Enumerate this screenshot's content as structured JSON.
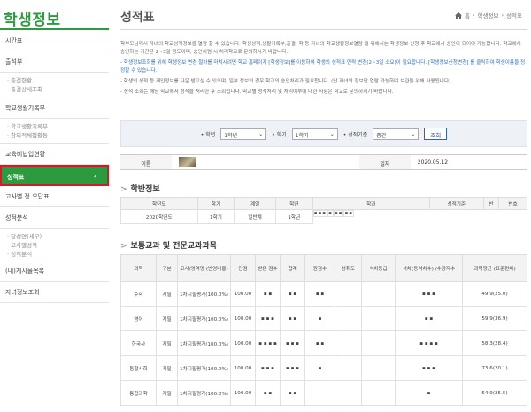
{
  "sidebar": {
    "title": "학생정보",
    "items": [
      {
        "label": "시간표"
      },
      {
        "label": "출석부"
      },
      {
        "label": "출결현황 · 출결상세조회",
        "sub": [
          "· 출결현황",
          "· 출결상세조회"
        ]
      },
      {
        "label": "학교생활기록부"
      },
      {
        "label": "· 학교생활기록부 · 창의적체험활동",
        "sub": [
          "· 학교생활기록부",
          "· 창의적체험활동"
        ]
      },
      {
        "label": "교육비납입현황"
      },
      {
        "label": "성적표",
        "active": true
      },
      {
        "label": "고사별 정 오답표"
      },
      {
        "label": "성적분석"
      },
      {
        "label": "· 성적분석 · 과목별",
        "sub": [
          "· 달성연(세부)",
          "· 고사별성적",
          "· 성적분석"
        ]
      },
      {
        "label": "(내)게시물목록"
      },
      {
        "label": "자녀정보조회"
      }
    ]
  },
  "header": {
    "title": "성적표",
    "breadcrumb": [
      "홈",
      "학생정보",
      "성적표"
    ]
  },
  "description": {
    "lines": [
      "학부모님께서 자녀의 학교성적정보를 열람 할 수 있습니다. 학생성적,생활기록부,출결, 학 등 자녀의 학교생활정보열람 을 위해서는 학생정보 신청 후 학교에서 승인이 되어야 가능합니다. 학교에서 승인하는 기간은 2~3일 정도이며, 승인처럼 시 처리학교로 문의하시기 바랍니다.",
      "- 학생정보조회를 위해 학생정보 변경 절차를 마치시려면 학교 홈페이지 [학생정보]를 이용하여 학생의 성적표 연락 변경(2~3일 소요)이 필요합니다. [학생정보신청변경] 를 클릭하여 학생이름을 정정할 수 있습니다.",
      "- 학생의 성적 등 개인정보를 다운 받으실 수 있으며, 일부 정보의 경우 학교의 승인처리가 필요합니다. (단 자녀의 정보만 열람 가능하며 보관을 위해 사용됩니다)",
      "- 성적 조회는 해당 학교에서 성적을 처리한 후 조회됩니다. 학교별 성적처리 및 처리여부에 대한 사항은 학교로 문의하시기 바랍니다."
    ],
    "link_label": "[학생정보신청변경]"
  },
  "filter": {
    "year_label": "• 학년",
    "year_value": "1학년",
    "term_label": "• 학기",
    "term_value": "1학기",
    "criteria_label": "• 성적기준",
    "criteria_value": "중간",
    "search_label": "조회"
  },
  "info": {
    "name_label": "이름",
    "date_label": "일자",
    "date_value": "2020.05.12"
  },
  "student_section": {
    "title": "학반정보",
    "headers": [
      "학년도",
      "학기",
      "계열",
      "학년",
      "학과",
      "성적기준",
      "반",
      "번호"
    ],
    "row": [
      "2020학년도",
      "1학기",
      "일반계",
      "1학년",
      "▪▪▪",
      "▪",
      "▪▪",
      "▪▪"
    ]
  },
  "grades_section": {
    "title": "보통교과 및 전문교과과목",
    "headers": [
      "과목",
      "구분",
      "고사/영역명 (반영비율)",
      "만점",
      "받은 점수",
      "합계",
      "원점수",
      "성취도",
      "석차등급",
      "석차(동석차수) /수강자수",
      "과목평균 (표준편차)"
    ],
    "rows": [
      [
        "수학",
        "지필",
        "1차지필평가(100.0%)",
        "100.00",
        "▪ ▪",
        "▪ ▪",
        "▪ ▪",
        "",
        "",
        "▪ ▪ ▪",
        "49.9(25.0)"
      ],
      [
        "영어",
        "지필",
        "1차지필평가(100.0%)",
        "100.00",
        "▪ ▪ ▪",
        "▪ ▪",
        "▪",
        "",
        "",
        "▪ ▪",
        "59.9(36.9)"
      ],
      [
        "한국사",
        "지필",
        "1차지필평가(100.0%)",
        "100.00",
        "▪ ▪ ▪ ▪",
        "▪ ▪ ▪",
        "▪ ▪",
        "",
        "",
        "▪ ▪ ▪ ▪",
        "58.3(28.4)"
      ],
      [
        "통합사회",
        "지필",
        "1차지필평가(100.0%)",
        "100.00",
        "▪ ▪ ▪",
        "▪ ▪ ▪",
        "▪",
        "",
        "",
        "▪ ▪ ▪",
        "73.6(20.1)"
      ],
      [
        "통합과학",
        "지필",
        "1차지필평가(100.0%)",
        "100.00",
        "▪ ▪",
        "▪ ▪",
        "",
        "",
        "",
        "▪",
        "54.9(25.5)"
      ]
    ]
  }
}
